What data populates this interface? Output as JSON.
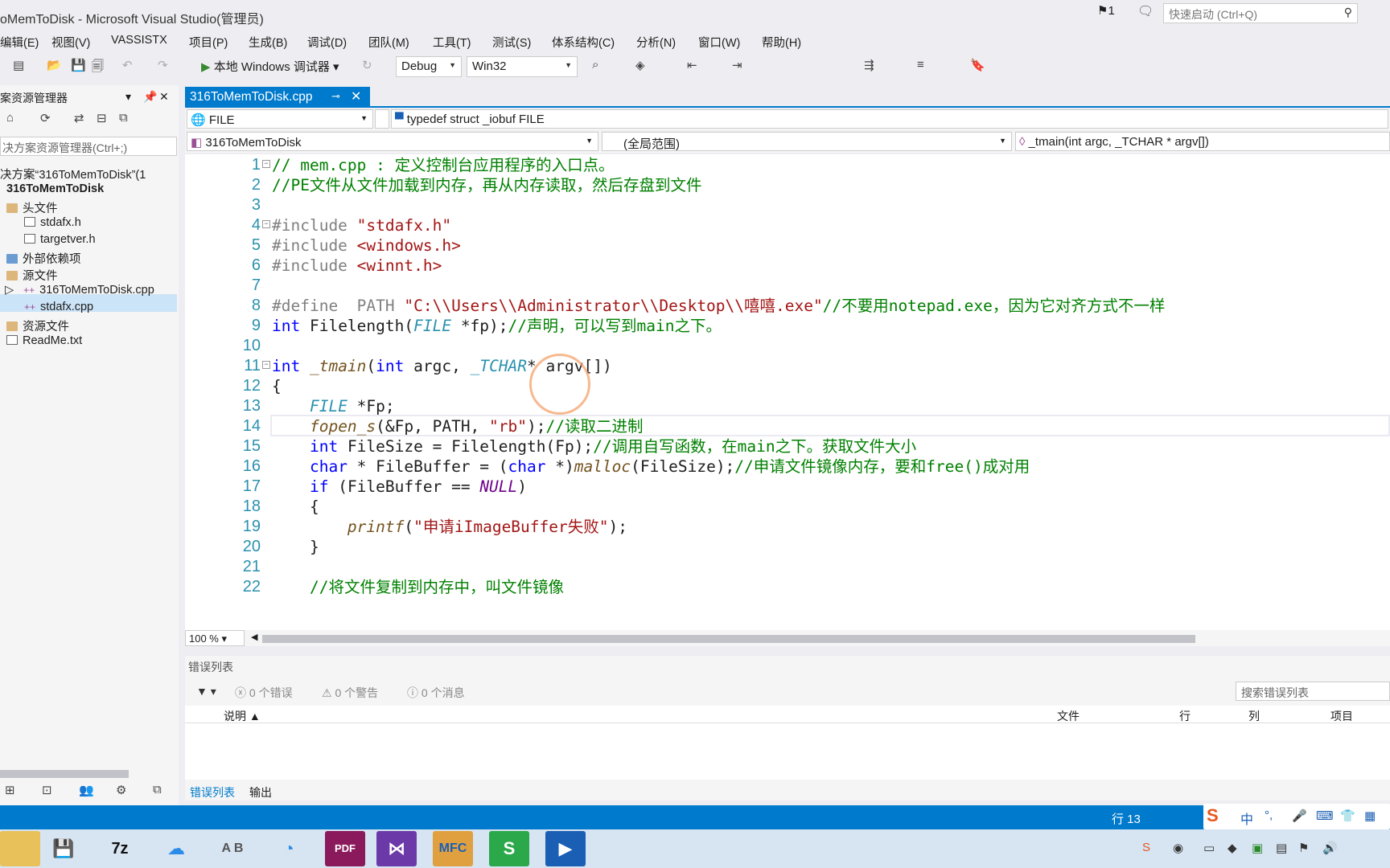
{
  "window": {
    "title": "oMemToDisk - Microsoft Visual Studio(管理员)",
    "notif_count": "1",
    "quick_launch": "快速启动 (Ctrl+Q)"
  },
  "menu": [
    "编辑(E)",
    "视图(V)",
    "VASSISTX",
    "项目(P)",
    "生成(B)",
    "调试(D)",
    "团队(M)",
    "工具(T)",
    "测试(S)",
    "体系结构(C)",
    "分析(N)",
    "窗口(W)",
    "帮助(H)"
  ],
  "toolbar": {
    "run_label": "本地 Windows 调试器",
    "config": "Debug",
    "platform": "Win32"
  },
  "solution_explorer": {
    "title": "案资源管理器",
    "search": "决方案资源管理器(Ctrl+;)",
    "items": [
      {
        "label": "决方案“316ToMemToDisk”(1",
        "kind": "solution"
      },
      {
        "label": "316ToMemToDisk",
        "kind": "project"
      },
      {
        "label": "头文件",
        "kind": "folder"
      },
      {
        "label": "stdafx.h",
        "kind": "header"
      },
      {
        "label": "targetver.h",
        "kind": "header"
      },
      {
        "label": "外部依赖项",
        "kind": "folder"
      },
      {
        "label": "源文件",
        "kind": "folder"
      },
      {
        "label": "316ToMemToDisk.cpp",
        "kind": "cpp"
      },
      {
        "label": "stdafx.cpp",
        "kind": "cpp"
      },
      {
        "label": "资源文件",
        "kind": "folder"
      },
      {
        "label": "ReadMe.txt",
        "kind": "text"
      }
    ]
  },
  "editor": {
    "tab": "316ToMemToDisk.cpp",
    "nav": {
      "scope_left": "FILE",
      "scope_right": "typedef struct _iobuf FILE",
      "project": "316ToMemToDisk",
      "global": "(全局范围)",
      "member": "_tmain(int argc, _TCHAR * argv[])"
    },
    "zoom": "100 %",
    "lines": [
      {
        "n": "1",
        "parts": [
          [
            "cm",
            "// mem.cpp : 定义控制台应用程序的入口点。"
          ]
        ]
      },
      {
        "n": "2",
        "parts": [
          [
            "cm",
            "//PE文件从文件加载到内存，再从内存读取，然后存盘到文件"
          ]
        ]
      },
      {
        "n": "3",
        "parts": []
      },
      {
        "n": "4",
        "parts": [
          [
            "pp",
            "#include "
          ],
          [
            "str",
            "\"stdafx.h\""
          ]
        ]
      },
      {
        "n": "5",
        "parts": [
          [
            "pp",
            "#include "
          ],
          [
            "str",
            "<windows.h>"
          ]
        ]
      },
      {
        "n": "6",
        "parts": [
          [
            "pp",
            "#include "
          ],
          [
            "str",
            "<winnt.h>"
          ]
        ]
      },
      {
        "n": "7",
        "parts": []
      },
      {
        "n": "8",
        "parts": [
          [
            "pp",
            "#define  PATH "
          ],
          [
            "str",
            "\"C:\\\\Users\\\\Administrator\\\\Desktop\\\\嘻嘻.exe\""
          ],
          [
            "cm",
            "//不要用notepad.exe，因为它对齐方式不一样"
          ]
        ]
      },
      {
        "n": "9",
        "parts": [
          [
            "kw",
            "int "
          ],
          [
            "",
            "Filelength("
          ],
          [
            "ty",
            "FILE"
          ],
          [
            "",
            " *fp);"
          ],
          [
            "cm",
            "//声明，可以写到main之下。"
          ]
        ]
      },
      {
        "n": "10",
        "parts": []
      },
      {
        "n": "11",
        "parts": [
          [
            "kw",
            "int "
          ],
          [
            "fn",
            "_tmain"
          ],
          [
            "",
            "("
          ],
          [
            "kw",
            "int "
          ],
          [
            "",
            "argc, "
          ],
          [
            "ty",
            "_TCHAR"
          ],
          [
            "",
            "* argv[])"
          ]
        ]
      },
      {
        "n": "12",
        "parts": [
          [
            "",
            "{"
          ]
        ]
      },
      {
        "n": "13",
        "parts": [
          [
            "",
            "    "
          ],
          [
            "ty",
            "FILE"
          ],
          [
            "",
            " *Fp;"
          ]
        ]
      },
      {
        "n": "14",
        "parts": [
          [
            "",
            "    "
          ],
          [
            "fn",
            "fopen_s"
          ],
          [
            "",
            "(&Fp, PATH, "
          ],
          [
            "str",
            "\"rb\""
          ],
          [
            "",
            ");"
          ],
          [
            "cm",
            "//读取二进制"
          ]
        ]
      },
      {
        "n": "15",
        "parts": [
          [
            "",
            "    "
          ],
          [
            "kw",
            "int "
          ],
          [
            "",
            "FileSize = Filelength(Fp);"
          ],
          [
            "cm",
            "//调用自写函数，在main之下。获取文件大小"
          ]
        ]
      },
      {
        "n": "16",
        "parts": [
          [
            "",
            "    "
          ],
          [
            "kw",
            "char "
          ],
          [
            "",
            "* FileBuffer = ("
          ],
          [
            "kw",
            "char "
          ],
          [
            "",
            "*)"
          ],
          [
            "fn",
            "malloc"
          ],
          [
            "",
            "(FileSize);"
          ],
          [
            "cm",
            "//申请文件镜像内存，要和free()成对用"
          ]
        ]
      },
      {
        "n": "17",
        "parts": [
          [
            "",
            "    "
          ],
          [
            "kw",
            "if "
          ],
          [
            "",
            "(FileBuffer == "
          ],
          [
            "mac",
            "NULL"
          ],
          [
            "",
            ")"
          ]
        ]
      },
      {
        "n": "18",
        "parts": [
          [
            "",
            "    {"
          ]
        ]
      },
      {
        "n": "19",
        "parts": [
          [
            "",
            "        "
          ],
          [
            "fn",
            "printf"
          ],
          [
            "",
            "("
          ],
          [
            "str",
            "\"申请iImageBuffer失败\""
          ],
          [
            "",
            ");"
          ]
        ]
      },
      {
        "n": "20",
        "parts": [
          [
            "",
            "    }"
          ]
        ]
      },
      {
        "n": "21",
        "parts": []
      },
      {
        "n": "22",
        "parts": [
          [
            "",
            "    "
          ],
          [
            "cm",
            "//将文件复制到内存中，叫文件镜像"
          ]
        ]
      }
    ]
  },
  "error_list": {
    "title": "错误列表",
    "errors": "0 个错误",
    "warnings": "0 个警告",
    "messages": "0 个消息",
    "search": "搜索错误列表",
    "columns": {
      "desc": "说明",
      "file": "文件",
      "line": "行",
      "col": "列",
      "project": "项目"
    },
    "tabs": [
      "错误列表",
      "输出"
    ]
  },
  "status": {
    "line": "行 13"
  },
  "ime": {
    "lang": "中"
  },
  "taskbar": {
    "apps": [
      "文件",
      "7z",
      "百度网盘",
      "AB",
      "浏览器",
      "PDF",
      "Visual Studio",
      "MFC",
      "S",
      "录屏"
    ]
  },
  "colors": {
    "accent": "#007acc",
    "comment": "#008000",
    "keyword": "#0000ff",
    "string": "#a31515",
    "type": "#2b91af"
  }
}
